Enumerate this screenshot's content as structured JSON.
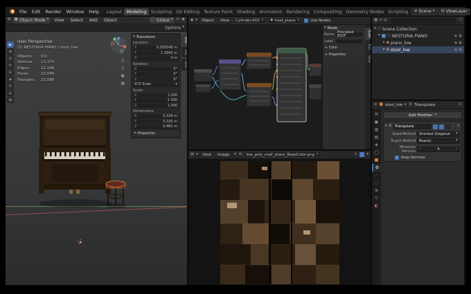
{
  "colors": {
    "accent": "#4772b3",
    "selection": "#e87d0d"
  },
  "icons": {
    "chevron": "▾",
    "chevron_right": "▸",
    "close": "×",
    "check": "✓",
    "search": "◎",
    "funnel": "▽",
    "dots": "⋮",
    "pin": "⊙",
    "star": "∗",
    "folder": "⊟",
    "camera": "▣",
    "eye": "◉",
    "mesh": "▲",
    "collection": "▢",
    "layers": "▤",
    "world": "◯",
    "object": "■",
    "gear": "⚙",
    "tool": "⚒",
    "particles": "∴",
    "physics": "◌",
    "constraint": "⊗",
    "material": "◐",
    "scene": "◈",
    "output": "▥",
    "shield": "◆",
    "left": "‹",
    "right": "›",
    "editor_vp": "⊞",
    "editor_node": "◆",
    "editor_image": "▤",
    "editor_outliner": "▦",
    "props_editor": "≡",
    "mesh_data": "▽"
  },
  "topbar": {
    "menus": [
      "File",
      "Edit",
      "Render",
      "Window",
      "Help"
    ],
    "tabs": [
      "Layout",
      "Modeling",
      "Sculpting",
      "UV Editing",
      "Texture Paint",
      "Shading",
      "Animation",
      "Rendering",
      "Compositing",
      "Geometry Nodes",
      "Scripting"
    ],
    "scene_label": "Scene",
    "view_layer_label": "ViewLayer"
  },
  "viewport": {
    "header": {
      "mode": "Object Mode",
      "menus": [
        "View",
        "Select",
        "Add",
        "Object"
      ],
      "orientation": "Global",
      "options": "Options"
    },
    "toolbar": [
      {
        "name": "select-box",
        "glyph": "►"
      },
      {
        "name": "cursor",
        "glyph": "⊕"
      },
      {
        "name": "move",
        "glyph": "┼"
      },
      {
        "name": "rotate",
        "glyph": "↻"
      },
      {
        "name": "scale",
        "glyph": "⊡"
      },
      {
        "name": "transform",
        "glyph": "◈"
      },
      {
        "name": "annotate",
        "glyph": "✎"
      },
      {
        "name": "measure",
        "glyph": "∠"
      },
      {
        "name": "add-cube",
        "glyph": "⊞"
      }
    ],
    "overlay": {
      "perspective": "User Perspective",
      "breadcrumb": "(1) NESTORIA PIANO | stool_low",
      "stats": [
        {
          "k": "Objects",
          "v": "0/2"
        },
        {
          "k": "Vertices",
          "v": "11,370"
        },
        {
          "k": "Edges",
          "v": "22,196"
        },
        {
          "k": "Faces",
          "v": "22,046"
        },
        {
          "k": "Triangles",
          "v": "22,088"
        }
      ]
    },
    "gizmo_tools": [
      {
        "name": "zoom",
        "glyph": "◎"
      },
      {
        "name": "pan",
        "glyph": "┼"
      },
      {
        "name": "camera-view",
        "glyph": "▣"
      },
      {
        "name": "toggle-perspective",
        "glyph": "▦"
      }
    ],
    "transform_panel": {
      "title": "Transform",
      "location_label": "Location:",
      "rows_location": [
        {
          "axis": "X",
          "value": "0.050548 m"
        },
        {
          "axis": "Y",
          "value": "1.3943 m"
        },
        {
          "axis": "Z",
          "value": "0 m"
        }
      ],
      "rotation_label": "Rotation:",
      "rows_rotation": [
        {
          "axis": "X",
          "value": "0°"
        },
        {
          "axis": "Y",
          "value": "0°"
        },
        {
          "axis": "Z",
          "value": "0°"
        }
      ],
      "rotation_mode": "XYZ Euler",
      "scale_label": "Scale:",
      "rows_scale": [
        {
          "axis": "X",
          "value": "1.000"
        },
        {
          "axis": "Y",
          "value": "1.000"
        },
        {
          "axis": "Z",
          "value": "1.000"
        }
      ],
      "dimensions_label": "Dimensions:",
      "rows_dimensions": [
        {
          "axis": "X",
          "value": "0.326 m"
        },
        {
          "axis": "Y",
          "value": "0.326 m"
        },
        {
          "axis": "Z",
          "value": "0.481 m"
        }
      ],
      "collapsed_section": "Properties",
      "tabs": [
        "Item",
        "Tool",
        "View"
      ]
    }
  },
  "node_editor": {
    "header": {
      "menus": [
        "Object",
        "View"
      ],
      "slot": "Cylinder.003",
      "material": "mod_piano",
      "use_nodes_label": "Use Nodes"
    },
    "side_panel": {
      "section": "Node",
      "name_label": "Name",
      "name_value": "Principled BSDF",
      "label_label": "Label",
      "label_value": "",
      "collapsed": [
        "Color",
        "Properties"
      ],
      "tabs": [
        "Node",
        "Tool",
        "View"
      ]
    }
  },
  "image_editor": {
    "header": {
      "menus": [
        "View",
        "Image"
      ],
      "filename": "low_poly_mall_piano_BaseColor.png"
    }
  },
  "outliner": {
    "rows": [
      {
        "label": "Scene Collection"
      },
      {
        "label": "NESTORIA PIANO"
      },
      {
        "label": "piano_low"
      },
      {
        "label": "stool_low"
      }
    ]
  },
  "properties": {
    "breadcrumb": {
      "object": "stool_low",
      "modifier": "Triangulate"
    },
    "add_modifier_label": "Add Modifier",
    "tabs": [
      {
        "name": "tool",
        "glyph": "⚒"
      },
      {
        "name": "render",
        "glyph": "▣"
      },
      {
        "name": "output",
        "glyph": "▥"
      },
      {
        "name": "view-layer",
        "glyph": "▤"
      },
      {
        "name": "scene",
        "glyph": "◈"
      },
      {
        "name": "world",
        "glyph": "◯"
      },
      {
        "name": "object",
        "glyph": "■"
      },
      {
        "name": "modifiers",
        "glyph": "⚙"
      },
      {
        "name": "particles",
        "glyph": "∴"
      },
      {
        "name": "physics",
        "glyph": "◌"
      },
      {
        "name": "constraints",
        "glyph": "⊗"
      },
      {
        "name": "object-data",
        "glyph": "▽"
      },
      {
        "name": "material",
        "glyph": "◐"
      }
    ],
    "modifier": {
      "name": "Triangulate",
      "rows": [
        {
          "label": "Quad Method",
          "value": "Shortest Diagonal"
        },
        {
          "label": "N-gon Method",
          "value": "Beauty"
        },
        {
          "label": "Minimum Vertices",
          "value": "4"
        }
      ],
      "checkbox_label": "Keep Normals"
    }
  }
}
